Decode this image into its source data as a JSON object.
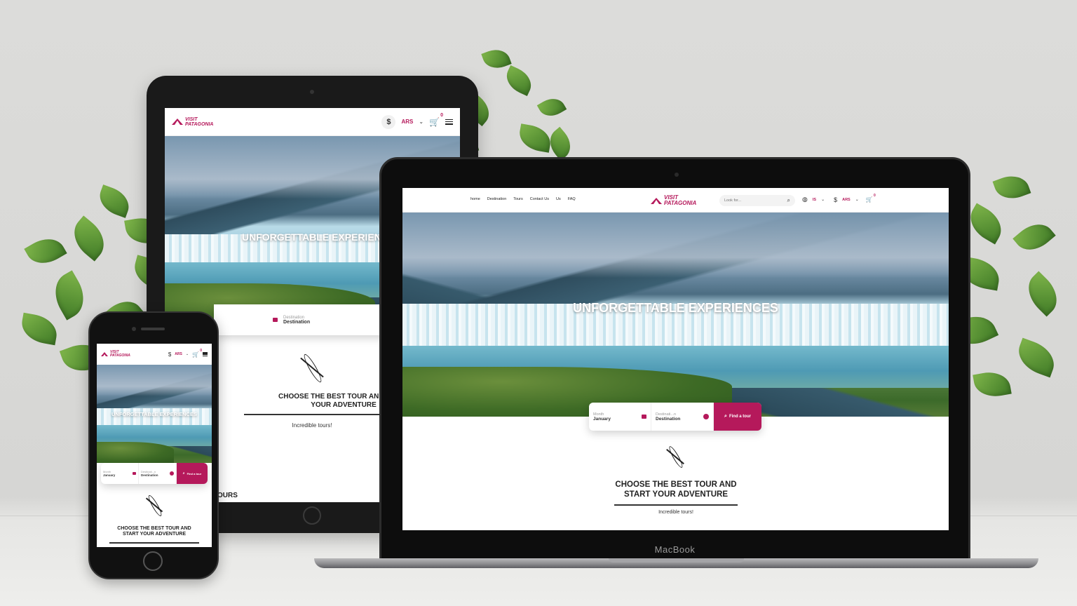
{
  "brand": {
    "line1": "VISIT",
    "line2": "PATAGONIA",
    "accent": "#b5195b"
  },
  "nav": [
    "home",
    "Destination",
    "Tours",
    "Contact Us",
    "Us",
    "FAQ"
  ],
  "search": {
    "placeholder": "Look for..."
  },
  "header": {
    "lang": "IS",
    "currency_symbol": "$",
    "currency": "ARS",
    "cart_count": "0"
  },
  "hero": {
    "title": "UNFORGETTABLE EXPERIENCES",
    "tablet_title": "UNFORGETTABLE EXPERIEN"
  },
  "tour_search": {
    "month_label": "Month",
    "month_value": "January",
    "dest_label": "Destination",
    "dest_value": "Destination",
    "phone_dest_label": "Destinati...n",
    "button": "Find a tour"
  },
  "section": {
    "title_line1": "CHOOSE THE BEST TOUR AND",
    "title_line2": "START YOUR ADVENTURE",
    "tablet_title_line1": "CHOOSE THE BEST TOUR AND START",
    "tablet_title_line2": "YOUR ADVENTURE",
    "subtitle": "Incredible tours!",
    "tablet_more": "OURS"
  },
  "device": {
    "laptop_label": "MacBook"
  },
  "icons": [
    "search-icon",
    "globe-icon",
    "cart-icon",
    "menu-icon",
    "calendar-icon",
    "compass-icon",
    "kayak-icon",
    "chevron-down-icon"
  ]
}
